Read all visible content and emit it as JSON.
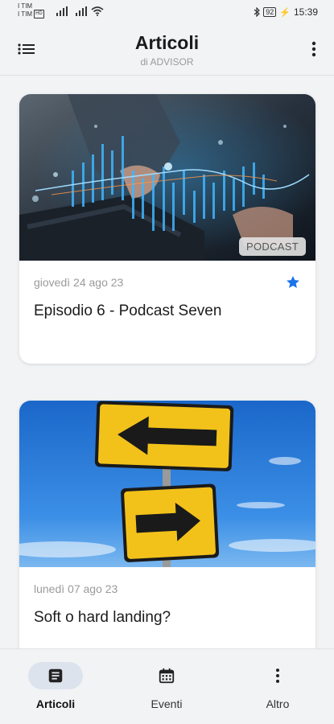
{
  "status_bar": {
    "carrier_1": "I TIM",
    "carrier_2": "I TIM",
    "carrier_2_badge": "HD",
    "battery": "92",
    "time": "15:39"
  },
  "header": {
    "title": "Articoli",
    "subtitle": "di ADVISOR"
  },
  "articles": [
    {
      "date": "giovedì 24 ago 23",
      "title": "Episodio 6 - Podcast Seven",
      "badge": "PODCAST",
      "favorite": true,
      "image": "hands-on-laptop-with-financial-chart"
    },
    {
      "date": "lunedì 07 ago 23",
      "title": "Soft o hard landing?",
      "image": "yellow-arrow-road-signs-sky"
    }
  ],
  "bottom_nav": {
    "items": [
      {
        "label": "Articoli",
        "icon": "article-icon",
        "active": true
      },
      {
        "label": "Eventi",
        "icon": "calendar-icon",
        "active": false
      },
      {
        "label": "Altro",
        "icon": "more-vert-icon",
        "active": false
      }
    ]
  },
  "colors": {
    "background": "#f2f3f5",
    "accent_star": "#1a73e8",
    "active_pill": "#dde3ec"
  }
}
